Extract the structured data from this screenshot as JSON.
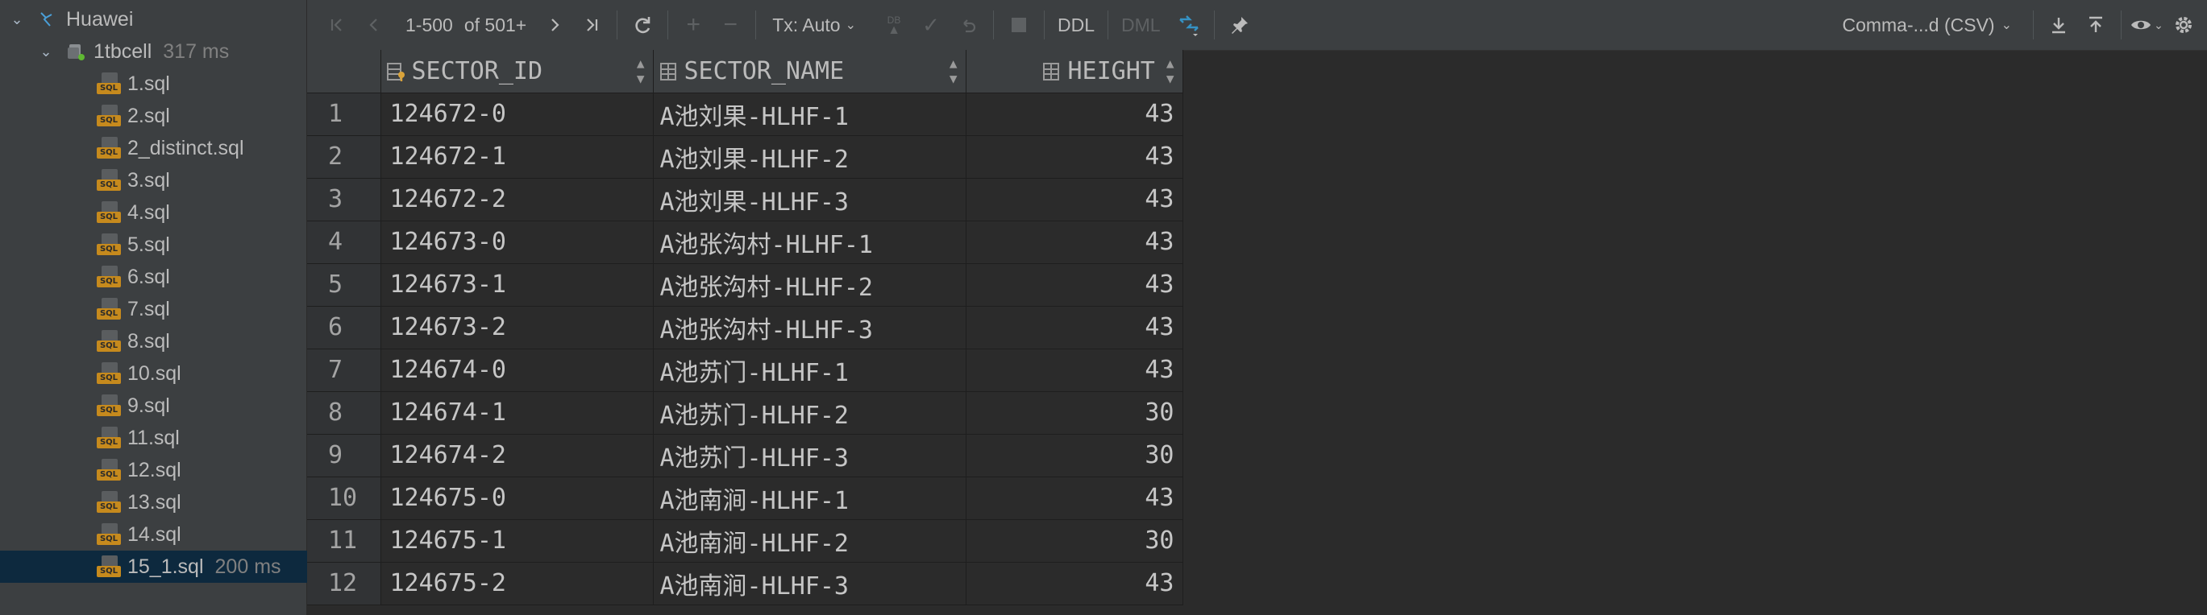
{
  "sidebar": {
    "root": {
      "label": "Huawei"
    },
    "connection": {
      "label": "1tbcell",
      "time": "317 ms"
    },
    "files": [
      {
        "label": "1.sql",
        "time": ""
      },
      {
        "label": "2.sql",
        "time": ""
      },
      {
        "label": "2_distinct.sql",
        "time": ""
      },
      {
        "label": "3.sql",
        "time": ""
      },
      {
        "label": "4.sql",
        "time": ""
      },
      {
        "label": "5.sql",
        "time": ""
      },
      {
        "label": "6.sql",
        "time": ""
      },
      {
        "label": "7.sql",
        "time": ""
      },
      {
        "label": "8.sql",
        "time": ""
      },
      {
        "label": "10.sql",
        "time": ""
      },
      {
        "label": "9.sql",
        "time": ""
      },
      {
        "label": "11.sql",
        "time": ""
      },
      {
        "label": "12.sql",
        "time": ""
      },
      {
        "label": "13.sql",
        "time": ""
      },
      {
        "label": "14.sql",
        "time": ""
      },
      {
        "label": "15_1.sql",
        "time": "200 ms"
      }
    ],
    "sql_badge": "SQL"
  },
  "toolbar": {
    "range": "1-500",
    "of_total": "of 501+",
    "tx": "Tx: Auto",
    "db_badge": "DB",
    "ddl": "DDL",
    "dml": "DML",
    "export_format": "Comma-...d (CSV)"
  },
  "grid": {
    "columns": [
      "SECTOR_ID",
      "SECTOR_NAME",
      "HEIGHT"
    ],
    "rows": [
      {
        "n": "1",
        "id": "124672-0",
        "name": "A池刘果-HLHF-1",
        "height": "43"
      },
      {
        "n": "2",
        "id": "124672-1",
        "name": "A池刘果-HLHF-2",
        "height": "43"
      },
      {
        "n": "3",
        "id": "124672-2",
        "name": "A池刘果-HLHF-3",
        "height": "43"
      },
      {
        "n": "4",
        "id": "124673-0",
        "name": "A池张沟村-HLHF-1",
        "height": "43"
      },
      {
        "n": "5",
        "id": "124673-1",
        "name": "A池张沟村-HLHF-2",
        "height": "43"
      },
      {
        "n": "6",
        "id": "124673-2",
        "name": "A池张沟村-HLHF-3",
        "height": "43"
      },
      {
        "n": "7",
        "id": "124674-0",
        "name": "A池苏门-HLHF-1",
        "height": "43"
      },
      {
        "n": "8",
        "id": "124674-1",
        "name": "A池苏门-HLHF-2",
        "height": "30"
      },
      {
        "n": "9",
        "id": "124674-2",
        "name": "A池苏门-HLHF-3",
        "height": "30"
      },
      {
        "n": "10",
        "id": "124675-0",
        "name": "A池南涧-HLHF-1",
        "height": "43"
      },
      {
        "n": "11",
        "id": "124675-1",
        "name": "A池南涧-HLHF-2",
        "height": "30"
      },
      {
        "n": "12",
        "id": "124675-2",
        "name": "A池南涧-HLHF-3",
        "height": "43"
      }
    ]
  }
}
